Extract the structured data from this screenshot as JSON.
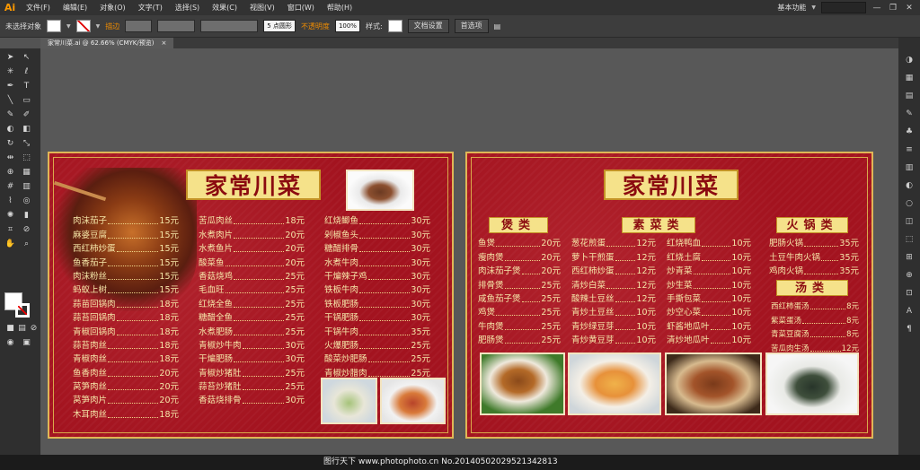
{
  "app": {
    "logo": "Ai",
    "workspace": "基本功能",
    "window_controls": [
      "—",
      "❐",
      "✕"
    ]
  },
  "menu": [
    "文件(F)",
    "编辑(E)",
    "对象(O)",
    "文字(T)",
    "选择(S)",
    "效果(C)",
    "视图(V)",
    "窗口(W)",
    "帮助(H)"
  ],
  "control": {
    "selection": "未选择对象",
    "stroke_label": "描边",
    "brush": "5 点圆形",
    "opacity_label": "不透明度",
    "opacity_value": "100%",
    "style_label": "样式:",
    "doc_setup": "文档设置",
    "prefs": "首选项"
  },
  "tab": {
    "title": "家常川菜.ai @ 62.66% (CMYK/预览)",
    "close": "×"
  },
  "left_board": {
    "title": "家常川菜",
    "col1": [
      {
        "name": "肉沫茄子",
        "price": "15元"
      },
      {
        "name": "麻婆豆腐",
        "price": "15元"
      },
      {
        "name": "西红柿炒蛋",
        "price": "15元"
      },
      {
        "name": "鱼香茄子",
        "price": "15元"
      },
      {
        "name": "肉沫粉丝",
        "price": "15元"
      },
      {
        "name": "蚂蚁上树",
        "price": "15元"
      },
      {
        "name": "蒜苗回锅肉",
        "price": "18元"
      },
      {
        "name": "蒜苔回锅肉",
        "price": "18元"
      },
      {
        "name": "青椒回锅肉",
        "price": "18元"
      },
      {
        "name": "蒜苔肉丝",
        "price": "18元"
      },
      {
        "name": "青椒肉丝",
        "price": "18元"
      },
      {
        "name": "鱼香肉丝",
        "price": "20元"
      },
      {
        "name": "莴笋肉丝",
        "price": "20元"
      },
      {
        "name": "莴笋肉片",
        "price": "20元"
      },
      {
        "name": "木耳肉丝",
        "price": "18元"
      }
    ],
    "col2": [
      {
        "name": "苦瓜肉丝",
        "price": "18元"
      },
      {
        "name": "水煮肉片",
        "price": "20元"
      },
      {
        "name": "水煮鱼片",
        "price": "20元"
      },
      {
        "name": "酸菜鱼",
        "price": "20元"
      },
      {
        "name": "香菇烧鸡",
        "price": "25元"
      },
      {
        "name": "毛血旺",
        "price": "25元"
      },
      {
        "name": "红烧全鱼",
        "price": "25元"
      },
      {
        "name": "糖醋全鱼",
        "price": "25元"
      },
      {
        "name": "水煮肥肠",
        "price": "25元"
      },
      {
        "name": "青椒炒牛肉",
        "price": "30元"
      },
      {
        "name": "干煸肥肠",
        "price": "30元"
      },
      {
        "name": "青椒炒猪肚",
        "price": "25元"
      },
      {
        "name": "蒜苔炒猪肚",
        "price": "25元"
      },
      {
        "name": "香菇烧排骨",
        "price": "30元"
      }
    ],
    "col3": [
      {
        "name": "红烧鲫鱼",
        "price": "30元"
      },
      {
        "name": "剁椒鱼头",
        "price": "30元"
      },
      {
        "name": "糖醋排骨",
        "price": "30元"
      },
      {
        "name": "水煮牛肉",
        "price": "30元"
      },
      {
        "name": "干煸辣子鸡",
        "price": "30元"
      },
      {
        "name": "铁板牛肉",
        "price": "30元"
      },
      {
        "name": "铁板肥肠",
        "price": "30元"
      },
      {
        "name": "干锅肥肠",
        "price": "30元"
      },
      {
        "name": "干锅牛肉",
        "price": "35元"
      },
      {
        "name": "火爆肥肠",
        "price": "25元"
      },
      {
        "name": "酸菜炒肥肠",
        "price": "25元"
      },
      {
        "name": "青椒炒腊肉",
        "price": "25元"
      }
    ]
  },
  "right_board": {
    "title": "家常川菜",
    "sec_bao": "煲类",
    "sec_veg": "素菜类",
    "sec_hotpot": "火锅类",
    "sec_soup": "汤类",
    "bao": [
      {
        "name": "鱼煲",
        "price": "20元"
      },
      {
        "name": "瘦肉煲",
        "price": "20元"
      },
      {
        "name": "肉沫茄子煲",
        "price": "20元"
      },
      {
        "name": "排骨煲",
        "price": "25元"
      },
      {
        "name": "咸鱼茄子煲",
        "price": "25元"
      },
      {
        "name": "鸡煲",
        "price": "25元"
      },
      {
        "name": "牛肉煲",
        "price": "25元"
      },
      {
        "name": "肥肠煲",
        "price": "25元"
      }
    ],
    "veg1": [
      {
        "name": "葱花煎蛋",
        "price": "12元"
      },
      {
        "name": "萝卜干煎蛋",
        "price": "12元"
      },
      {
        "name": "西红柿炒蛋",
        "price": "12元"
      },
      {
        "name": "清炒白菜",
        "price": "12元"
      },
      {
        "name": "酸辣土豆丝",
        "price": "12元"
      },
      {
        "name": "青炒土豆丝",
        "price": "10元"
      },
      {
        "name": "青炒绿豆芽",
        "price": "10元"
      },
      {
        "name": "青炒黄豆芽",
        "price": "10元"
      }
    ],
    "veg2": [
      {
        "name": "红烧鸭血",
        "price": "10元"
      },
      {
        "name": "红烧土腐",
        "price": "10元"
      },
      {
        "name": "炒青菜",
        "price": "10元"
      },
      {
        "name": "炒生菜",
        "price": "10元"
      },
      {
        "name": "手撕包菜",
        "price": "10元"
      },
      {
        "name": "炒空心菜",
        "price": "10元"
      },
      {
        "name": "虾酱地瓜叶",
        "price": "10元"
      },
      {
        "name": "清炒地瓜叶",
        "price": "10元"
      }
    ],
    "hotpot": [
      {
        "name": "肥肠火锅",
        "price": "35元"
      },
      {
        "name": "土豆牛肉火锅",
        "price": "35元"
      },
      {
        "name": "鸡肉火锅",
        "price": "35元"
      }
    ],
    "soup": [
      {
        "name": "西红柿蛋汤",
        "price": "8元"
      },
      {
        "name": "紫菜蛋汤",
        "price": "8元"
      },
      {
        "name": "青菜豆腐汤",
        "price": "8元"
      },
      {
        "name": "苦瓜肉生汤",
        "price": "12元"
      }
    ]
  },
  "watermark": "图行天下 www.photophoto.cn No.20140502029521342813",
  "colors": {
    "board_red": "#a3131f",
    "gold": "#e0b656",
    "menu_text": "#f5e6a8",
    "title_bg": "#f5e28a"
  }
}
